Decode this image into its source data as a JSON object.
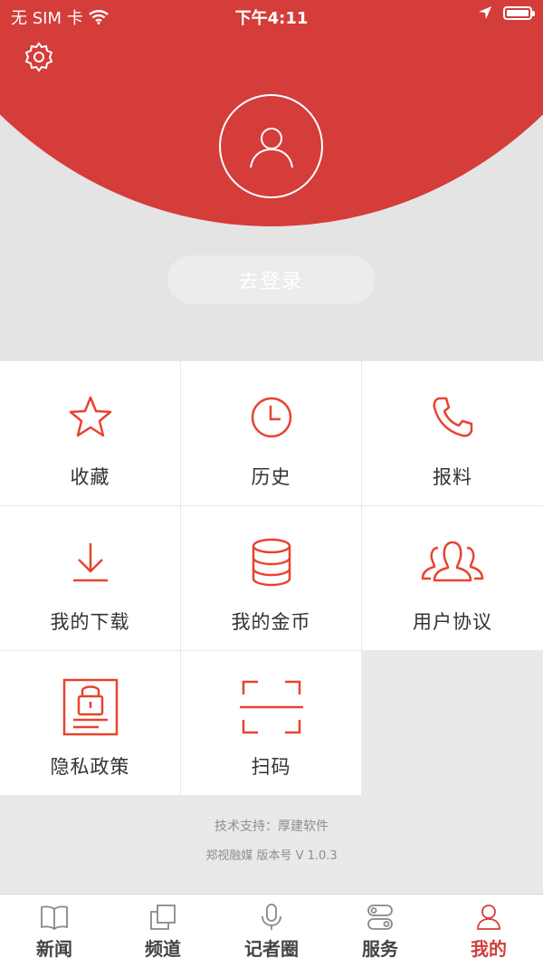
{
  "status_bar": {
    "carrier": "无 SIM 卡",
    "time": "下午4:11"
  },
  "profile": {
    "login_label": "去登录"
  },
  "menu": {
    "items": [
      {
        "label": "收藏",
        "icon": "star-icon"
      },
      {
        "label": "历史",
        "icon": "clock-icon"
      },
      {
        "label": "报料",
        "icon": "phone-icon"
      },
      {
        "label": "我的下载",
        "icon": "download-icon"
      },
      {
        "label": "我的金币",
        "icon": "coin-stack-icon"
      },
      {
        "label": "用户协议",
        "icon": "users-icon"
      },
      {
        "label": "隐私政策",
        "icon": "privacy-lock-icon"
      },
      {
        "label": "扫码",
        "icon": "scan-icon"
      }
    ]
  },
  "footer": {
    "support": "技术支持：厚建软件",
    "version": "郑视融媒 版本号 V 1.0.3"
  },
  "tabs": [
    {
      "label": "新闻",
      "icon": "book-icon"
    },
    {
      "label": "频道",
      "icon": "channel-icon"
    },
    {
      "label": "记者圈",
      "icon": "microphone-icon"
    },
    {
      "label": "服务",
      "icon": "service-icon"
    },
    {
      "label": "我的",
      "icon": "person-icon",
      "active": true
    }
  ],
  "colors": {
    "accent": "#d43d3a",
    "icon_red": "#e8432f",
    "background": "#e9e9ea"
  }
}
